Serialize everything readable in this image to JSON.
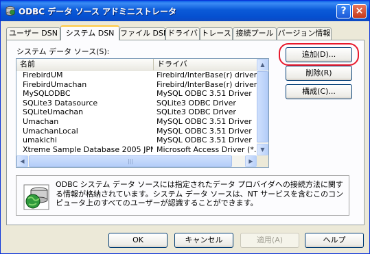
{
  "window": {
    "title": "ODBC データ ソース アドミニストレータ",
    "help_label": "?",
    "close_label": "×"
  },
  "tabs": [
    {
      "label": "ユーザー DSN"
    },
    {
      "label": "システム DSN",
      "active": true
    },
    {
      "label": "ファイル DSN"
    },
    {
      "label": "ドライバ"
    },
    {
      "label": "トレース"
    },
    {
      "label": "接続プール"
    },
    {
      "label": "バージョン情報"
    }
  ],
  "system_dsn": {
    "label": "システム データ ソース(S):",
    "columns": [
      "名前",
      "ドライバ"
    ],
    "rows": [
      {
        "name": "FirebirdUM",
        "driver": "Firebird/InterBase(r) driver"
      },
      {
        "name": "FirebirdUmachan",
        "driver": "Firebird/InterBase(r) driver"
      },
      {
        "name": "MySQLODBC",
        "driver": "MySQL ODBC 3.51 Driver"
      },
      {
        "name": "SQLite3 Datasource",
        "driver": "SQLite3 ODBC Driver"
      },
      {
        "name": "SQLiteUmachan",
        "driver": "SQLite3 ODBC Driver"
      },
      {
        "name": "Umachan",
        "driver": "MySQL ODBC 3.51 Driver"
      },
      {
        "name": "UmachanLocal",
        "driver": "MySQL ODBC 3.51 Driver"
      },
      {
        "name": "umakichi",
        "driver": "MySQL ODBC 3.51 Driver"
      },
      {
        "name": "Xtreme Sample Database 2005 JPN",
        "driver": "Microsoft Access Driver (*.mdb)"
      }
    ],
    "scroll_left": "◀",
    "scroll_right": "▶",
    "scroll_up": "▲",
    "scroll_down": "▼",
    "grip": "|||"
  },
  "side_buttons": {
    "add": "追加(D)...",
    "remove": "削除(R)",
    "configure": "構成(C)..."
  },
  "info": {
    "text": "ODBC システム データ ソースには指定されたデータ プロバイダへの接続方法に関する情報が格納されています。システム データ ソースは、NT サービスを含むこのコンピュータ上のすべてのユーザーが認識することができます。"
  },
  "footer": {
    "ok": "OK",
    "cancel": "キャンセル",
    "apply": "適用(A)",
    "help": "ヘルプ"
  },
  "colors": {
    "highlight_ring": "#e8192c",
    "titlebar": "#0550d0"
  }
}
